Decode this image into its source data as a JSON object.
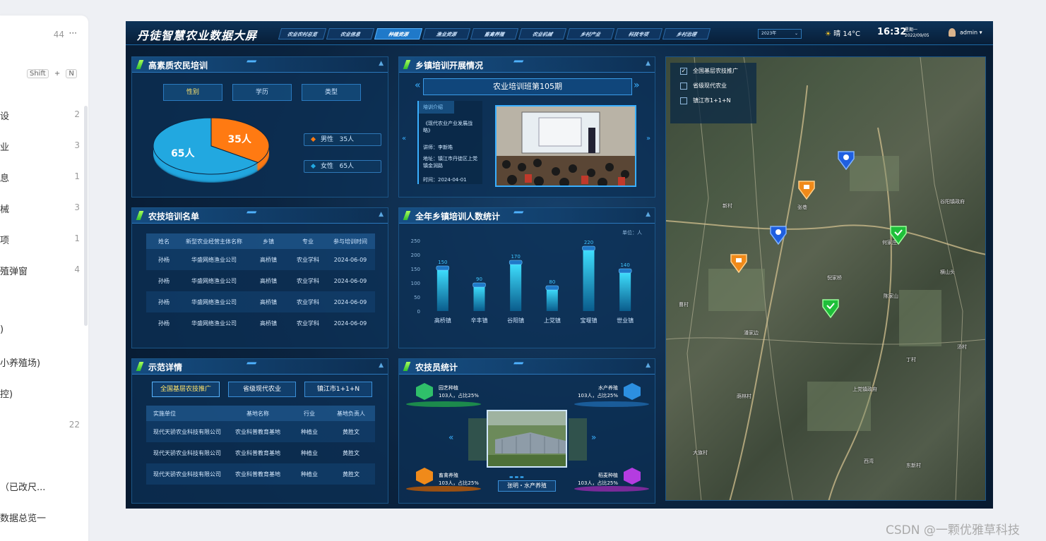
{
  "doc": {
    "header_title": "",
    "top_count": "44",
    "top_more": "···",
    "shortcut": {
      "key1": "Shift",
      "plus": "+",
      "key2": "N"
    },
    "items": [
      {
        "label": "设",
        "count": "2"
      },
      {
        "label": "业",
        "count": "3"
      },
      {
        "label": "息",
        "count": "1"
      },
      {
        "label": "械",
        "count": "3"
      },
      {
        "label": "项",
        "count": "1"
      },
      {
        "label": "殖弹窗",
        "count": "4"
      },
      {
        "label": ")",
        "count": ""
      },
      {
        "label": "小养殖场)",
        "count": ""
      },
      {
        "label": "控)",
        "count": ""
      },
      {
        "label": "",
        "count": "22"
      },
      {
        "label": "（已改尺...",
        "count": ""
      },
      {
        "label": "数据总览一",
        "count": ""
      }
    ]
  },
  "dash": {
    "brand": "丹徒智慧农业数据大屏",
    "nav": [
      "农业农村总览",
      "农业信息",
      "种植资源",
      "渔业资源",
      "畜禽养殖",
      "农业机械",
      "乡村产业",
      "科技专项",
      "乡村治理"
    ],
    "nav_active": 2,
    "year": "2023年",
    "weather": "晴 14°C",
    "sun_icon": "sun-icon",
    "time": "16:32",
    "weekday": "星期一",
    "date": "2022/09/05",
    "user": "admin"
  },
  "p1": {
    "title": "高素质农民培训",
    "tabs": [
      "性别",
      "学历",
      "类型"
    ],
    "pie": [
      {
        "label": "男性",
        "value": 35,
        "text": "35人",
        "color": "#ff7a12"
      },
      {
        "label": "女性",
        "value": 65,
        "text": "65人",
        "color": "#22a8e0"
      }
    ],
    "legend": [
      {
        "label": "男性",
        "value": "35人"
      },
      {
        "label": "女性",
        "value": "65人"
      }
    ]
  },
  "p2": {
    "title": "乡镇培训开展情况",
    "period": "农业培训班第105期",
    "intro_head": "培训介绍",
    "course": "《现代农业产业发展战略》",
    "lecturer": "讲师：李新皓",
    "address": "地址：镇江市丹徒区上党镇金润路",
    "time": "时间：2024-04-01"
  },
  "p3": {
    "title": "农技培训名单",
    "columns": [
      "姓名",
      "新型农业经营主体名称",
      "乡镇",
      "专业",
      "参与培训时间"
    ],
    "rows": [
      [
        "孙杨",
        "华盛网络渔业公司",
        "高桥镇",
        "农业学科",
        "2024-06-09"
      ],
      [
        "孙杨",
        "华盛网络渔业公司",
        "高桥镇",
        "农业学科",
        "2024-06-09"
      ],
      [
        "孙杨",
        "华盛网络渔业公司",
        "高桥镇",
        "农业学科",
        "2024-06-09"
      ],
      [
        "孙杨",
        "华盛网络渔业公司",
        "高桥镇",
        "农业学科",
        "2024-06-09"
      ]
    ]
  },
  "p4": {
    "title": "全年乡镇培训人数统计",
    "unit": "单位：人"
  },
  "chart_data": {
    "type": "bar",
    "title": "全年乡镇培训人数统计",
    "ylabel": "单位：人",
    "categories": [
      "高桥镇",
      "辛丰镇",
      "谷阳镇",
      "上党镇",
      "宝堰镇",
      "世业镇"
    ],
    "values": [
      150,
      90,
      170,
      80,
      220,
      140
    ],
    "ylim": [
      0,
      250
    ],
    "yticks": [
      0,
      50,
      100,
      150,
      200,
      250
    ],
    "grid": false
  },
  "p5": {
    "title": "示范详情",
    "tabs": [
      "全国基层农技推广",
      "省级现代农业",
      "镇江市1+1+N"
    ],
    "columns": [
      "实施单位",
      "基地名称",
      "行业",
      "基地负责人"
    ],
    "rows": [
      [
        "现代天骄农业科技有限公司",
        "农业科普教育基地",
        "种植业",
        "黄胜文"
      ],
      [
        "现代天骄农业科技有限公司",
        "农业科普教育基地",
        "种植业",
        "黄胜文"
      ],
      [
        "现代天骄农业科技有限公司",
        "农业科普教育基地",
        "种植业",
        "黄胜文"
      ]
    ]
  },
  "p6": {
    "title": "农技员统计",
    "stats": [
      {
        "name": "园艺种植",
        "value": "103人，占比25%",
        "color": "#2fbf6a"
      },
      {
        "name": "水产养殖",
        "value": "103人，占比25%",
        "color": "#2c8fe0"
      },
      {
        "name": "畜禽养殖",
        "value": "103人，占比25%",
        "color": "#f08a1a"
      },
      {
        "name": "稻麦种植",
        "value": "103人，占比25%",
        "color": "#b43ce0"
      }
    ],
    "caption": "张明・水产养殖"
  },
  "map": {
    "checks": [
      {
        "label": "全国基层农技推广",
        "checked": true
      },
      {
        "label": "省级现代农业",
        "checked": false
      },
      {
        "label": "镇江市1+1+N",
        "checked": false
      }
    ],
    "places": [
      "谷阳镇政府",
      "何家庄",
      "横山头",
      "陈家山",
      "上党镇政府",
      "丁村",
      "西湾",
      "倪家桥",
      "潘家边",
      "曹村",
      "张巷",
      "东新村",
      "大旗村",
      "荫林村",
      "新村",
      "汤村"
    ]
  },
  "watermark": "CSDN @一颗优雅草科技"
}
